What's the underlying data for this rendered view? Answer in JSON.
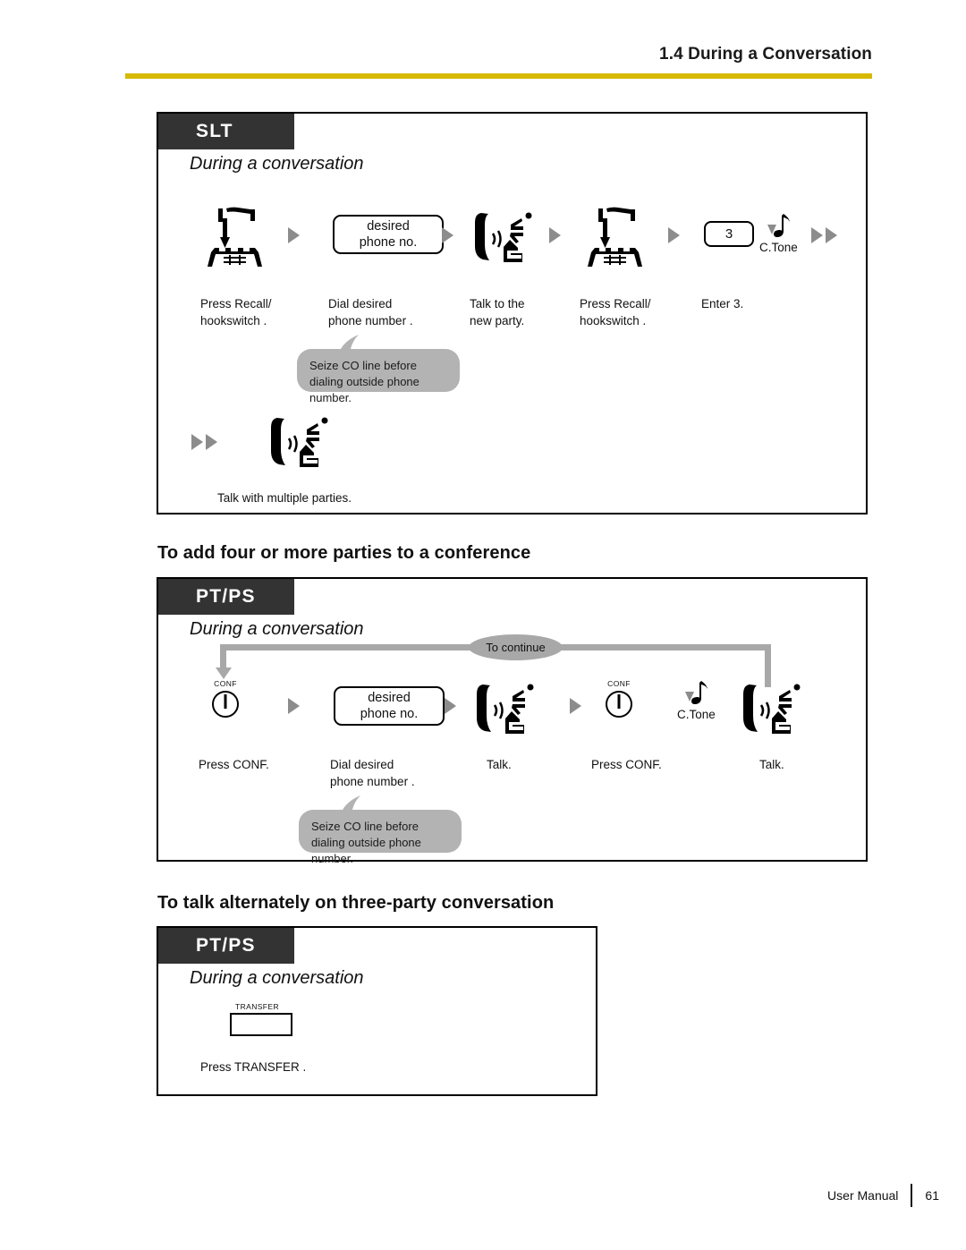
{
  "header": {
    "section_title": "1.4 During a Conversation",
    "rule_color": "#d7b900"
  },
  "footer": {
    "manual_label": "User Manual",
    "page_number": "61"
  },
  "sections": [
    {
      "id": "slt-conference",
      "heading": "",
      "tag": "SLT",
      "subhead": "During a conversation",
      "steps": [
        {
          "icon": "hookswitch-icon",
          "label": "Press Recall/\nhookswitch  ."
        },
        {
          "icon": "keybox",
          "key_line1": "desired",
          "key_line2": "phone  no.",
          "label": "Dial desired\nphone number  ."
        },
        {
          "icon": "talk-icon",
          "label": "Talk to the\nnew party."
        },
        {
          "icon": "hookswitch-icon",
          "label": "Press Recall/\nhookswitch  ."
        },
        {
          "icon": "numkey",
          "key": "3",
          "tone": "C.Tone",
          "label": "Enter 3."
        }
      ],
      "bubble": "Seize CO line before\ndialing outside phone number.",
      "final_step": {
        "icon": "talk-icon",
        "label": "Talk with multiple parties."
      }
    },
    {
      "id": "pt-ps-four-parties",
      "heading": "To add four or more parties to a conference",
      "tag": "PT/PS",
      "subhead": "During a conversation",
      "loop_label": "To continue",
      "steps": [
        {
          "icon": "conf-key-icon",
          "key_cap": "CONF",
          "label": "Press CONF."
        },
        {
          "icon": "keybox",
          "key_line1": "desired",
          "key_line2": "phone  no.",
          "label": "Dial desired\nphone number  ."
        },
        {
          "icon": "talk-icon",
          "label": "Talk."
        },
        {
          "icon": "conf-key-icon",
          "key_cap": "CONF",
          "tone": "C.Tone",
          "label": "Press CONF."
        },
        {
          "icon": "talk-icon",
          "label": "Talk."
        }
      ],
      "bubble": "Seize CO line before\ndialing outside phone number."
    },
    {
      "id": "pt-ps-alternate-talk",
      "heading": "To talk alternately on three-party conversation",
      "tag": "PT/PS",
      "subhead": "During a conversation",
      "steps": [
        {
          "icon": "transfer-key-icon",
          "key_cap": "TRANSFER",
          "label": "Press TRANSFER ."
        }
      ]
    }
  ]
}
